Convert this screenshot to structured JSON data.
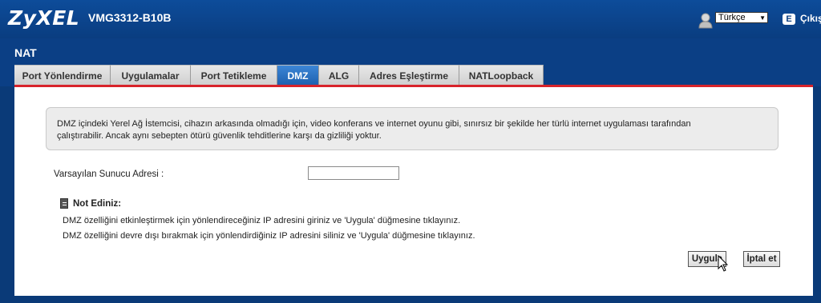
{
  "header": {
    "logo": "ZyXEL",
    "model": "VMG3312-B10B",
    "language": "Türkçe",
    "logout_label": "Çıkış"
  },
  "section_title": "NAT",
  "tabs": [
    {
      "label": "Port Yönlendirme",
      "active": false
    },
    {
      "label": "Uygulamalar",
      "active": false
    },
    {
      "label": "Port Tetikleme",
      "active": false
    },
    {
      "label": "DMZ",
      "active": true
    },
    {
      "label": "ALG",
      "active": false
    },
    {
      "label": "Adres Eşleştirme",
      "active": false
    },
    {
      "label": "NATLoopback",
      "active": false
    }
  ],
  "info": {
    "line1": "DMZ içindeki Yerel Ağ İstemcisi, cihazın arkasında olmadığı için, video konferans ve internet oyunu gibi, sınırsız bir şekilde her türlü internet uygulaması tarafından",
    "line2": "çalıştırabilir. Ancak aynı sebepten ötürü güvenlik tehditlerine karşı da gizliliği yoktur."
  },
  "form": {
    "server_label": "Varsayılan Sunucu Adresi :",
    "server_value": ""
  },
  "note": {
    "title": "Not Ediniz:",
    "line1": "DMZ özelliğini etkinleştirmek için yönlendireceğiniz IP adresini giriniz ve 'Uygula' düğmesine tıklayınız.",
    "line2": "DMZ özelliğini devre dışı bırakmak için yönlendirdiğiniz IP adresini siliniz ve 'Uygula' düğmesine tıklayınız."
  },
  "buttons": {
    "apply": "Uygula",
    "cancel": "İptal et"
  },
  "colors": {
    "header_blue": "#0a3d80",
    "active_tab": "#2a72c4",
    "accent_red": "#d8232a"
  }
}
